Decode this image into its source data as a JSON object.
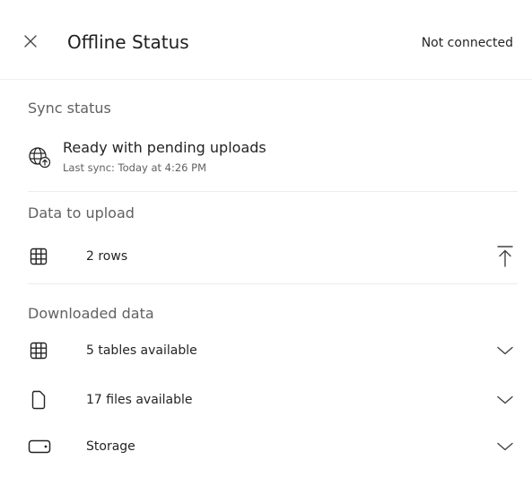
{
  "header": {
    "title": "Offline Status",
    "connection_status": "Not connected",
    "close_icon": "close-icon"
  },
  "sync": {
    "heading": "Sync status",
    "status": "Ready with pending uploads",
    "last_sync": "Last sync: Today at 4:26 PM",
    "icon": "globe-sync-icon"
  },
  "upload": {
    "heading": "Data to upload",
    "items": [
      {
        "label": "2 rows",
        "icon": "table-icon",
        "action_icon": "upload-icon"
      }
    ]
  },
  "downloaded": {
    "heading": "Downloaded data",
    "items": [
      {
        "label": "5 tables available",
        "icon": "table-icon",
        "action_icon": "chevron-down-icon"
      },
      {
        "label": "17 files available",
        "icon": "document-icon",
        "action_icon": "chevron-down-icon"
      },
      {
        "label": "Storage",
        "icon": "storage-icon",
        "action_icon": "chevron-down-icon"
      }
    ]
  }
}
